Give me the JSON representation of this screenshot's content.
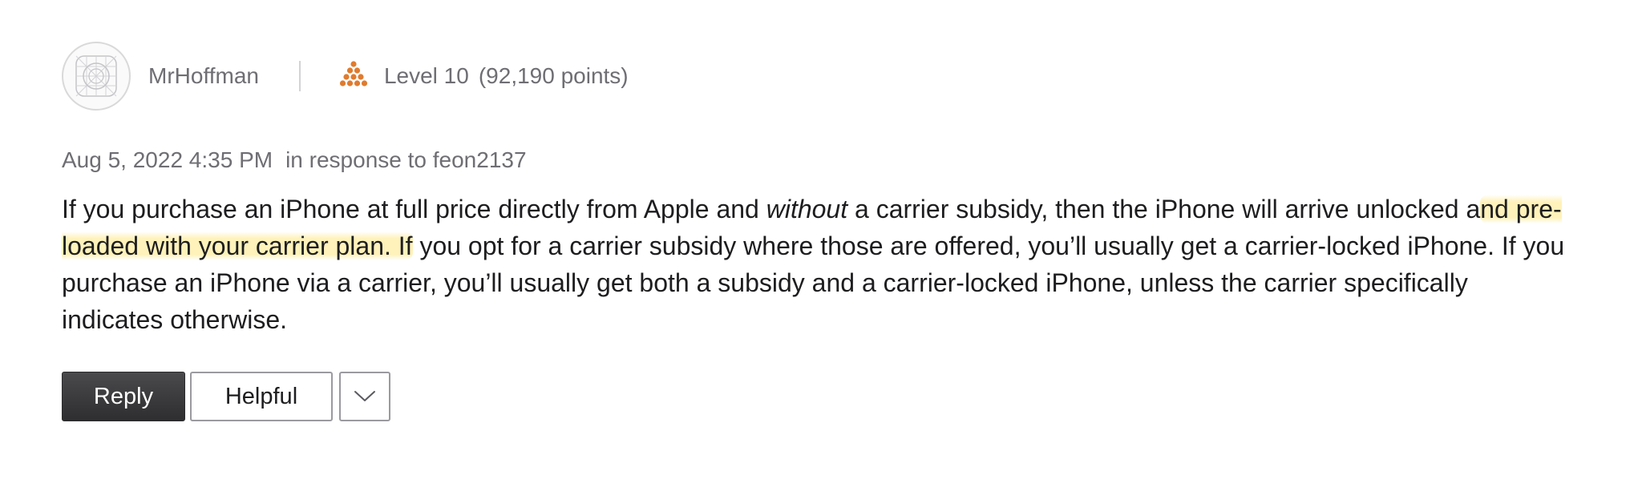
{
  "author": {
    "name": "MrHoffman",
    "level": "Level 10",
    "points": "(92,190 points)",
    "level_icon_color": "#e07b2e"
  },
  "post": {
    "date": "Aug 5, 2022 4:35 PM",
    "response_prefix": "in response to",
    "response_to": "feon2137",
    "body": {
      "seg1": "If you purchase an iPhone at full price directly from Apple and ",
      "seg_italic": "without",
      "seg2": " a carrier subsidy, then the iPhone will arrive unlocked a",
      "seg_highlight": "nd pre-loaded with your carrier plan. If",
      "seg3": " you opt for a carrier subsidy where those are offered, you’ll usually get a carrier-locked iPhone. If you purchase an iPhone via a carrier, you’ll usually get both a subsidy and a carrier-locked iPhone, unless the carrier specifically indicates otherwise."
    },
    "highlight_color": "#ffe882"
  },
  "actions": {
    "reply_label": "Reply",
    "helpful_label": "Helpful",
    "more_icon": "chevron-down-icon"
  }
}
